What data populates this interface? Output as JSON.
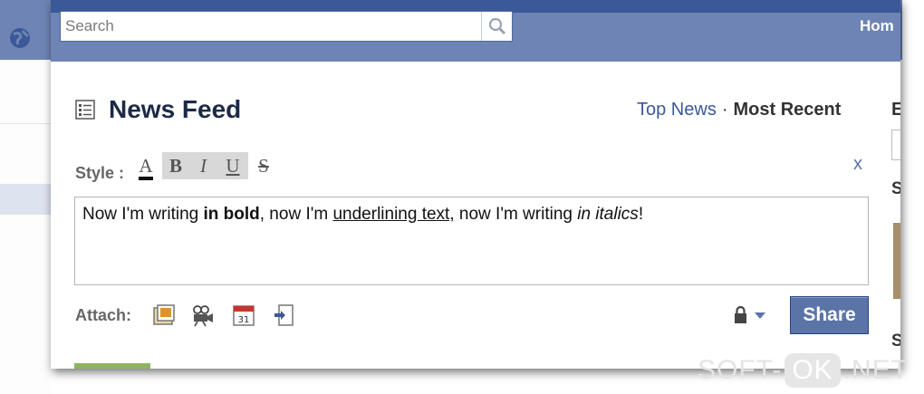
{
  "topbar": {
    "search_placeholder": "Search",
    "home_label": "Hom"
  },
  "feed": {
    "title": "News Feed",
    "sort_top": "Top News",
    "sort_separator": "·",
    "sort_recent": "Most Recent",
    "right_col_heading": "E"
  },
  "composer": {
    "style_label": "Style :",
    "style_buttons": {
      "color": "A",
      "bold": "B",
      "italic": "I",
      "underline": "U",
      "strike": "S"
    },
    "close_label": "x",
    "text_1": "Now I'm writing ",
    "text_bold": "in bold",
    "text_2": ", now I'm ",
    "text_underline": "underlining text,",
    "text_3": " now I'm writing ",
    "text_italic": "in italics",
    "text_4": "!",
    "attach_label": "Attach:",
    "attach_icons": [
      "photo-icon",
      "video-icon",
      "event-icon",
      "link-icon"
    ],
    "share_label": "Share"
  },
  "right_edge": {
    "s1": "S",
    "s2": "S"
  },
  "watermark": {
    "left": "SOFT-",
    "middle": "OK",
    "right": ".NET"
  },
  "colors": {
    "brand_blue": "#3b5998",
    "bar_blue": "#6d84b4",
    "button_blue": "#5b74a8"
  }
}
